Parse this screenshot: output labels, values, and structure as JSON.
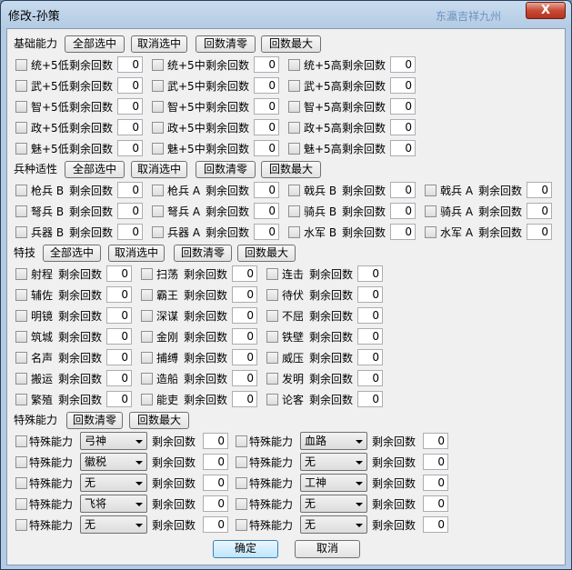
{
  "window": {
    "title": "修改-孙策",
    "title_tail": "东瀛吉祥九州",
    "close_label": "X"
  },
  "labels": {
    "remaining": "剩余回数",
    "special_ability": "特殊能力"
  },
  "sections": [
    {
      "title": "基础能力",
      "buttons": [
        "全部选中",
        "取消选中",
        "回数清零",
        "回数最大"
      ]
    },
    {
      "title": "兵种适性",
      "buttons": [
        "全部选中",
        "取消选中",
        "回数清零",
        "回数最大"
      ]
    },
    {
      "title": "特技",
      "buttons": [
        "全部选中",
        "取消选中",
        "回数清零",
        "回数最大"
      ]
    },
    {
      "title": "特殊能力",
      "buttons": [
        "回数清零",
        "回数最大"
      ]
    }
  ],
  "basic_items": [
    {
      "name": "统+5低",
      "count": "0"
    },
    {
      "name": "统+5中",
      "count": "0"
    },
    {
      "name": "统+5高",
      "count": "0"
    },
    {
      "name": "武+5低",
      "count": "0"
    },
    {
      "name": "武+5中",
      "count": "0"
    },
    {
      "name": "武+5高",
      "count": "0"
    },
    {
      "name": "智+5低",
      "count": "0"
    },
    {
      "name": "智+5中",
      "count": "0"
    },
    {
      "name": "智+5高",
      "count": "0"
    },
    {
      "name": "政+5低",
      "count": "0"
    },
    {
      "name": "政+5中",
      "count": "0"
    },
    {
      "name": "政+5高",
      "count": "0"
    },
    {
      "name": "魅+5低",
      "count": "0"
    },
    {
      "name": "魅+5中",
      "count": "0"
    },
    {
      "name": "魅+5高",
      "count": "0"
    }
  ],
  "troop_items": [
    {
      "name": "枪兵 B",
      "count": "0"
    },
    {
      "name": "枪兵 A",
      "count": "0"
    },
    {
      "name": "戟兵 B",
      "count": "0"
    },
    {
      "name": "戟兵 A",
      "count": "0"
    },
    {
      "name": "弩兵 B",
      "count": "0"
    },
    {
      "name": "弩兵 A",
      "count": "0"
    },
    {
      "name": "骑兵 B",
      "count": "0"
    },
    {
      "name": "骑兵 A",
      "count": "0"
    },
    {
      "name": "兵器 B",
      "count": "0"
    },
    {
      "name": "兵器 A",
      "count": "0"
    },
    {
      "name": "水军 B",
      "count": "0"
    },
    {
      "name": "水军 A",
      "count": "0"
    }
  ],
  "skill_items": [
    {
      "name": "射程",
      "count": "0"
    },
    {
      "name": "扫荡",
      "count": "0"
    },
    {
      "name": "连击",
      "count": "0"
    },
    {
      "name": "辅佐",
      "count": "0"
    },
    {
      "name": "霸王",
      "count": "0"
    },
    {
      "name": "待伏",
      "count": "0"
    },
    {
      "name": "明镜",
      "count": "0"
    },
    {
      "name": "深谋",
      "count": "0"
    },
    {
      "name": "不屈",
      "count": "0"
    },
    {
      "name": "筑城",
      "count": "0"
    },
    {
      "name": "金刚",
      "count": "0"
    },
    {
      "name": "铁壁",
      "count": "0"
    },
    {
      "name": "名声",
      "count": "0"
    },
    {
      "name": "捕缚",
      "count": "0"
    },
    {
      "name": "威压",
      "count": "0"
    },
    {
      "name": "搬运",
      "count": "0"
    },
    {
      "name": "造船",
      "count": "0"
    },
    {
      "name": "发明",
      "count": "0"
    },
    {
      "name": "繁殖",
      "count": "0"
    },
    {
      "name": "能吏",
      "count": "0"
    },
    {
      "name": "论客",
      "count": "0"
    }
  ],
  "special_items": [
    {
      "value": "弓神",
      "count": "0"
    },
    {
      "value": "血路",
      "count": "0"
    },
    {
      "value": "徽税",
      "count": "0"
    },
    {
      "value": "无",
      "count": "0"
    },
    {
      "value": "无",
      "count": "0"
    },
    {
      "value": "工神",
      "count": "0"
    },
    {
      "value": "飞将",
      "count": "0"
    },
    {
      "value": "无",
      "count": "0"
    },
    {
      "value": "无",
      "count": "0"
    },
    {
      "value": "无",
      "count": "0"
    }
  ],
  "footer": {
    "ok_label": "确定",
    "cancel_label": "取消"
  }
}
